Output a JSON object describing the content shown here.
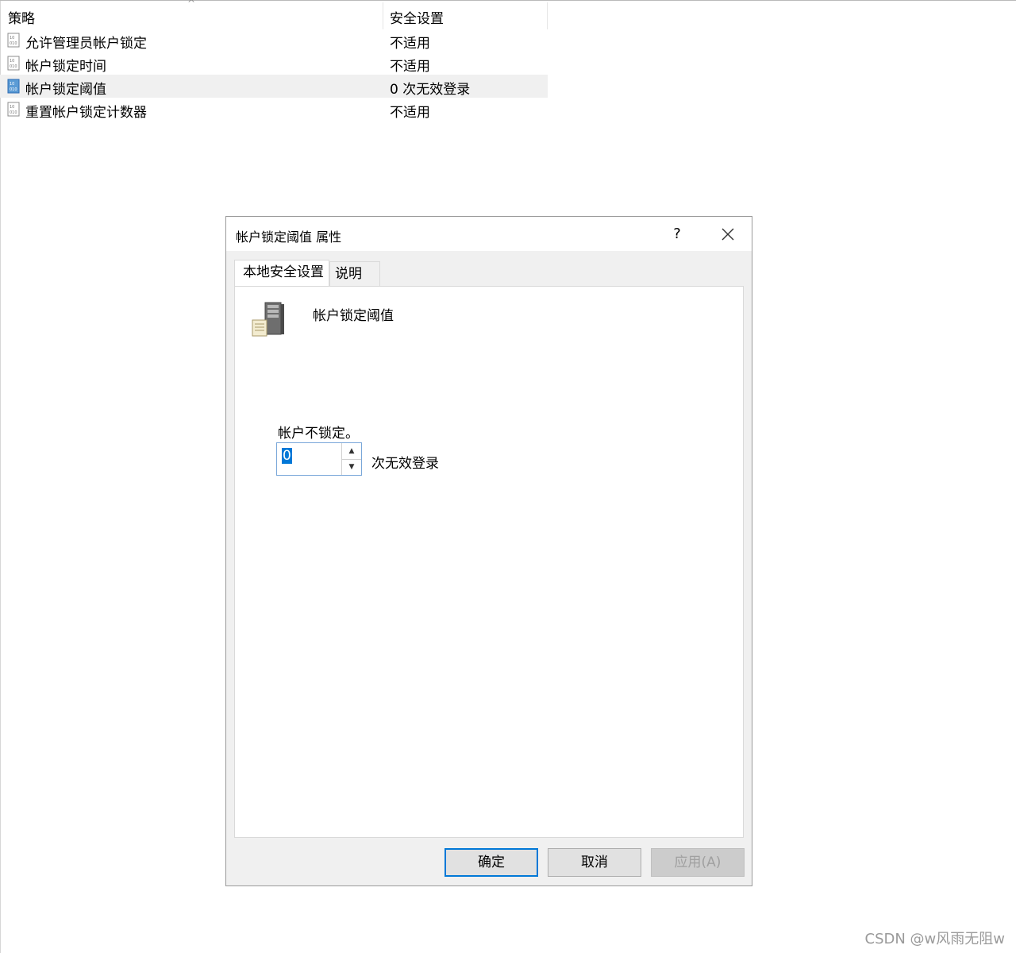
{
  "list": {
    "columns": [
      "策略",
      "安全设置"
    ],
    "rows": [
      {
        "name": "允许管理员帐户锁定",
        "value": "不适用",
        "selected": false
      },
      {
        "name": "帐户锁定时间",
        "value": "不适用",
        "selected": false
      },
      {
        "name": "帐户锁定阈值",
        "value": "0 次无效登录",
        "selected": true
      },
      {
        "name": "重置帐户锁定计数器",
        "value": "不适用",
        "selected": false
      }
    ]
  },
  "dialog": {
    "title": "帐户锁定阈值 属性",
    "help_label": "?",
    "tabs": [
      "本地安全设置",
      "说明"
    ],
    "policy_name": "帐户锁定阈值",
    "hint": "帐户不锁定。",
    "spinner_value": "0",
    "unit_label": "次无效登录",
    "buttons": {
      "ok": "确定",
      "cancel": "取消",
      "apply": "应用(A)"
    }
  },
  "watermark": "CSDN @w风雨无阻w",
  "icons": {
    "policy": "policy-doc-icon",
    "server": "server-icon",
    "close": "close-icon"
  },
  "colors": {
    "selection": "#0078d7",
    "row_selected_bg": "#f0f0f0"
  }
}
